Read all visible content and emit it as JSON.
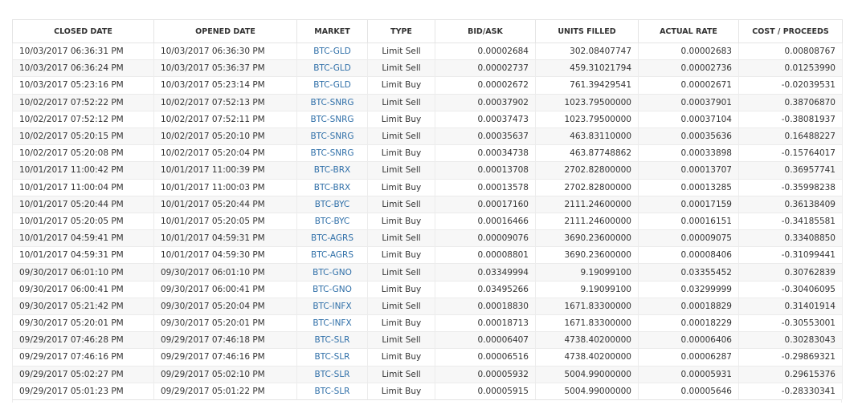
{
  "table": {
    "headers": [
      "CLOSED DATE",
      "OPENED DATE",
      "MARKET",
      "TYPE",
      "BID/ASK",
      "UNITS FILLED",
      "ACTUAL RATE",
      "COST / PROCEEDS"
    ],
    "rows": [
      [
        "10/03/2017 06:36:31 PM",
        "10/03/2017 06:36:30 PM",
        "BTC-GLD",
        "Limit Sell",
        "0.00002684",
        "302.08407747",
        "0.00002683",
        "0.00808767"
      ],
      [
        "10/03/2017 06:36:24 PM",
        "10/03/2017 05:36:37 PM",
        "BTC-GLD",
        "Limit Sell",
        "0.00002737",
        "459.31021794",
        "0.00002736",
        "0.01253990"
      ],
      [
        "10/03/2017 05:23:16 PM",
        "10/03/2017 05:23:14 PM",
        "BTC-GLD",
        "Limit Buy",
        "0.00002672",
        "761.39429541",
        "0.00002671",
        "-0.02039531"
      ],
      [
        "10/02/2017 07:52:22 PM",
        "10/02/2017 07:52:13 PM",
        "BTC-SNRG",
        "Limit Sell",
        "0.00037902",
        "1023.79500000",
        "0.00037901",
        "0.38706870"
      ],
      [
        "10/02/2017 07:52:12 PM",
        "10/02/2017 07:52:11 PM",
        "BTC-SNRG",
        "Limit Buy",
        "0.00037473",
        "1023.79500000",
        "0.00037104",
        "-0.38081937"
      ],
      [
        "10/02/2017 05:20:15 PM",
        "10/02/2017 05:20:10 PM",
        "BTC-SNRG",
        "Limit Sell",
        "0.00035637",
        "463.83110000",
        "0.00035636",
        "0.16488227"
      ],
      [
        "10/02/2017 05:20:08 PM",
        "10/02/2017 05:20:04 PM",
        "BTC-SNRG",
        "Limit Buy",
        "0.00034738",
        "463.87748862",
        "0.00033898",
        "-0.15764017"
      ],
      [
        "10/01/2017 11:00:42 PM",
        "10/01/2017 11:00:39 PM",
        "BTC-BRX",
        "Limit Sell",
        "0.00013708",
        "2702.82800000",
        "0.00013707",
        "0.36957741"
      ],
      [
        "10/01/2017 11:00:04 PM",
        "10/01/2017 11:00:03 PM",
        "BTC-BRX",
        "Limit Buy",
        "0.00013578",
        "2702.82800000",
        "0.00013285",
        "-0.35998238"
      ],
      [
        "10/01/2017 05:20:44 PM",
        "10/01/2017 05:20:44 PM",
        "BTC-BYC",
        "Limit Sell",
        "0.00017160",
        "2111.24600000",
        "0.00017159",
        "0.36138409"
      ],
      [
        "10/01/2017 05:20:05 PM",
        "10/01/2017 05:20:05 PM",
        "BTC-BYC",
        "Limit Buy",
        "0.00016466",
        "2111.24600000",
        "0.00016151",
        "-0.34185581"
      ],
      [
        "10/01/2017 04:59:41 PM",
        "10/01/2017 04:59:31 PM",
        "BTC-AGRS",
        "Limit Sell",
        "0.00009076",
        "3690.23600000",
        "0.00009075",
        "0.33408850"
      ],
      [
        "10/01/2017 04:59:31 PM",
        "10/01/2017 04:59:30 PM",
        "BTC-AGRS",
        "Limit Buy",
        "0.00008801",
        "3690.23600000",
        "0.00008406",
        "-0.31099441"
      ],
      [
        "09/30/2017 06:01:10 PM",
        "09/30/2017 06:01:10 PM",
        "BTC-GNO",
        "Limit Sell",
        "0.03349994",
        "9.19099100",
        "0.03355452",
        "0.30762839"
      ],
      [
        "09/30/2017 06:00:41 PM",
        "09/30/2017 06:00:41 PM",
        "BTC-GNO",
        "Limit Buy",
        "0.03495266",
        "9.19099100",
        "0.03299999",
        "-0.30406095"
      ],
      [
        "09/30/2017 05:21:42 PM",
        "09/30/2017 05:20:04 PM",
        "BTC-INFX",
        "Limit Sell",
        "0.00018830",
        "1671.83300000",
        "0.00018829",
        "0.31401914"
      ],
      [
        "09/30/2017 05:20:01 PM",
        "09/30/2017 05:20:01 PM",
        "BTC-INFX",
        "Limit Buy",
        "0.00018713",
        "1671.83300000",
        "0.00018229",
        "-0.30553001"
      ],
      [
        "09/29/2017 07:46:28 PM",
        "09/29/2017 07:46:18 PM",
        "BTC-SLR",
        "Limit Sell",
        "0.00006407",
        "4738.40200000",
        "0.00006406",
        "0.30283043"
      ],
      [
        "09/29/2017 07:46:16 PM",
        "09/29/2017 07:46:16 PM",
        "BTC-SLR",
        "Limit Buy",
        "0.00006516",
        "4738.40200000",
        "0.00006287",
        "-0.29869321"
      ],
      [
        "09/29/2017 05:02:27 PM",
        "09/29/2017 05:02:10 PM",
        "BTC-SLR",
        "Limit Sell",
        "0.00005932",
        "5004.99000000",
        "0.00005931",
        "0.29615376"
      ],
      [
        "09/29/2017 05:01:23 PM",
        "09/29/2017 05:01:22 PM",
        "BTC-SLR",
        "Limit Buy",
        "0.00005915",
        "5004.99000000",
        "0.00005646",
        "-0.28330341"
      ]
    ]
  },
  "colors": {
    "market_link": "#2f6fa8",
    "row_stripe": "#f7f7f7",
    "border": "#e4e4e4"
  }
}
